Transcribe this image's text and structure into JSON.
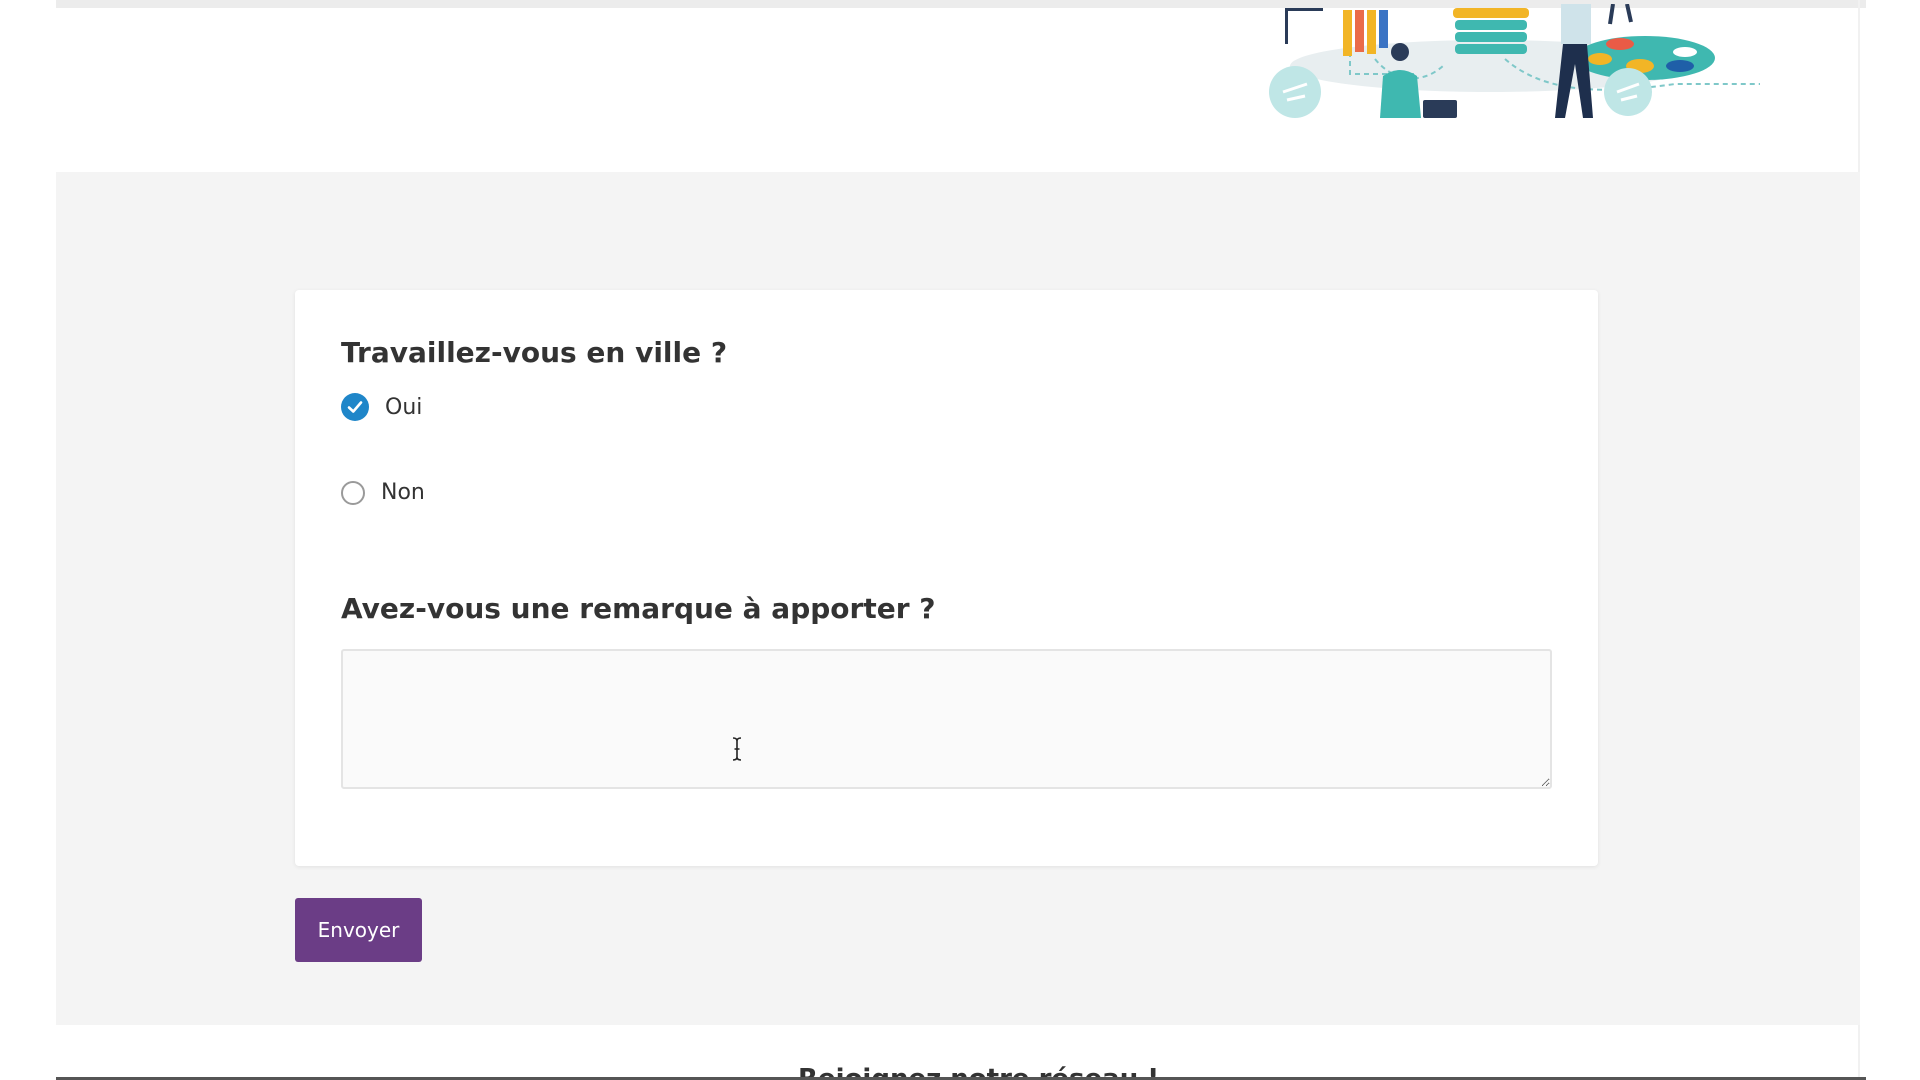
{
  "form": {
    "question_city": {
      "title": "Travaillez-vous en ville ?",
      "options": [
        {
          "label": "Oui",
          "checked": true
        },
        {
          "label": "Non",
          "checked": false
        }
      ]
    },
    "question_remark": {
      "title": "Avez-vous une remarque à apporter ?",
      "value": ""
    },
    "submit_label": "Envoyer"
  },
  "footer": {
    "heading": "Rejoignez notre réseau !"
  },
  "colors": {
    "accent_blue": "#1f86c9",
    "button_purple": "#6b3d86",
    "section_background": "#f4f4f4"
  },
  "icons": {
    "header_illustration": "team-collaboration-illustration",
    "checked_radio": "checkmark-icon",
    "cursor": "text-cursor-icon"
  }
}
